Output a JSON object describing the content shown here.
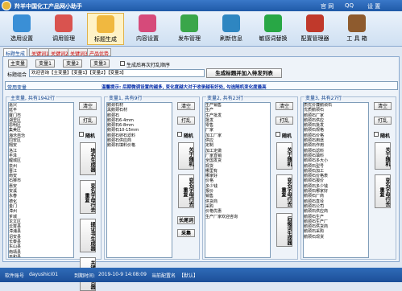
{
  "titlebar": {
    "title": "羚羊中国化工产品网小助手",
    "links": [
      "官 网",
      "QQ",
      "设 置"
    ]
  },
  "toolbar": [
    {
      "label": "选用设置",
      "color": "#3a8fd6"
    },
    {
      "label": "调用管理",
      "color": "#d9534f"
    },
    {
      "label": "标题生成",
      "color": "#f0b840",
      "selected": true
    },
    {
      "label": "内容设置",
      "color": "#d64a7a"
    },
    {
      "label": "发布管理",
      "color": "#3aa64a"
    },
    {
      "label": "刷新信息",
      "color": "#2e86c1"
    },
    {
      "label": "敏感词替换",
      "color": "#28a745"
    },
    {
      "label": "配置管理器",
      "color": "#c0392b"
    },
    {
      "label": "工 具 箱",
      "color": "#8e5b2e"
    }
  ],
  "tabs": [
    "标题生成",
    "关键词1",
    "关键词2",
    "关键词3",
    "产品优势"
  ],
  "top": {
    "main_var": "主变量",
    "var1": "变量1",
    "var2": "变量2",
    "var3": "变量3",
    "shuffle_label": "生成后再次打乱顺序",
    "combo_label": "标题组合",
    "combo_value": "欢迎咨询【主变量】【变量1】【变量2】【变量3】",
    "generate_button": "生成标题并加入待发列表"
  },
  "common_var": "常用变量",
  "tip": "温馨提示: 后期微调设置的越多, 变化度越大对于收录越有好处, 勾选随机变化度最高",
  "groups": [
    {
      "title": "主变量, 共有1942行",
      "items": [
        "嘉兴",
        "延平",
        "厦门市",
        "湖里区",
        "思明区",
        "集美区",
        "海沧自治",
        "同安区",
        "翔安",
        "洛江",
        "丰泽",
        "鲤城区",
        "泉州",
        "晋江",
        "南安",
        "石狮市",
        "惠安",
        "安溪",
        "永春",
        "德化",
        "金门",
        "漳州",
        "芗城",
        "龙文区",
        "云霄县",
        "漳浦县",
        "诏安县",
        "长泰县",
        "东山县",
        "南靖县",
        "平和县",
        "华安县",
        "龙海市",
        "莆田",
        "城厢区",
        "涵江区",
        "荔城区"
      ],
      "buttons": [
        "清空",
        "打乱"
      ],
      "random": "随机",
      "v_buttons": [
        "地名生成器",
        "变名字母行去重复",
        "提证书生成器",
        "关键词组合器"
      ]
    },
    {
      "title": "变量1, 共有9行",
      "items": [
        "鹅颈石材",
        "黑鹅颈石材",
        "鹅颈石",
        "鹅颈石6-4mm",
        "鹅颈石6-8mm",
        "鹅颈石10-15mm",
        "鹅颈石卵石滤料",
        "鹅颈石供应商",
        "鹅颈石填料价格"
      ],
      "buttons": [
        "清空",
        "打乱"
      ],
      "random": "随机",
      "v_buttons": [
        "关于随机",
        "变名字母行去重复"
      ],
      "h_buttons": [
        "长尾词",
        "采集"
      ]
    },
    {
      "title": "变量2, 共有23行",
      "items": [
        "生产销售",
        "生产",
        "生产批发",
        "批发",
        "零售",
        "厂家",
        "加工厂家",
        "供应",
        "定制",
        "加工定做",
        "厂家直销",
        "全国发货",
        "现货",
        "哪里有",
        "哪家好",
        "价格",
        "多少钱",
        "报价",
        "销售",
        "供货商",
        "采购",
        "价格优惠",
        "生产厂家欢迎咨询"
      ],
      "buttons": [
        "清空",
        "打乱"
      ],
      "random": "随机",
      "v_buttons": [
        "关于随机",
        "变名字母行去重复",
        "后缀词生成器"
      ]
    },
    {
      "title": "变量3, 共有27行",
      "items": [
        "质优价廉鹅颈石",
        "优质鹅颈石",
        "鹅颈石厂家",
        "鹅颈石供应",
        "鹅颈石批发",
        "鹅颈石规格",
        "鹅颈石价格",
        "鹅颈石用途",
        "鹅颈石作用",
        "鹅颈石滤料",
        "鹅颈石填料",
        "鹅颈石多大小",
        "鹅颈石型号",
        "鹅颈石加工",
        "鹅颈石价格表",
        "鹅颈石报价",
        "鹅颈石多少钱",
        "鹅颈石哪家好",
        "鹅颈石厂商",
        "鹅颈石直径",
        "鹅颈石公司",
        "鹅颈石供应商",
        "鹅颈石生产",
        "鹅颈石生产厂",
        "鹅颈石供货商",
        "鹅颈石采购",
        "鹅颈石现货"
      ],
      "buttons": [
        "清空",
        "打乱"
      ],
      "random": "随机",
      "v_buttons": [
        "关于随机",
        "变名字母行去重复"
      ]
    }
  ],
  "status": {
    "account_label": "软件账号",
    "account": "dayushici01",
    "expire_label": "到期时间:",
    "expire": "2019-10-9 14:08:09",
    "config_label": "当前配置名",
    "config": "【默认】"
  }
}
